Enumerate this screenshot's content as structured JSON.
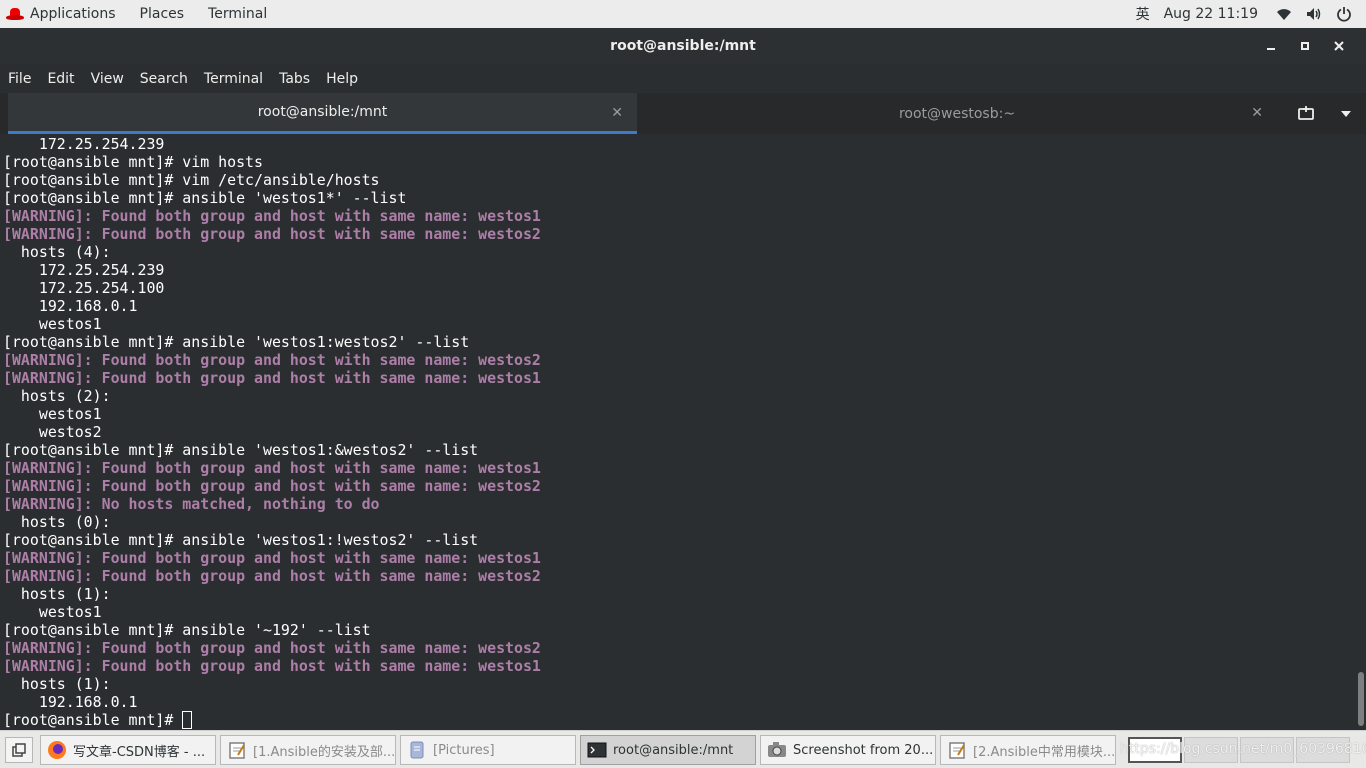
{
  "topbar": {
    "applications": "Applications",
    "places": "Places",
    "terminal": "Terminal",
    "ime": "英",
    "datetime": "Aug 22  11:19",
    "icons": [
      "wifi-icon",
      "volume-icon",
      "power-icon"
    ]
  },
  "window": {
    "title": "root@ansible:/mnt",
    "buttons": [
      "minimize",
      "maximize",
      "close"
    ]
  },
  "menubar": [
    "File",
    "Edit",
    "View",
    "Search",
    "Terminal",
    "Tabs",
    "Help"
  ],
  "tabs": [
    {
      "label": "root@ansible:/mnt",
      "active": true
    },
    {
      "label": "root@westosb:~",
      "active": false
    }
  ],
  "terminal": {
    "lines": [
      {
        "text": "    172.25.254.239",
        "type": "normal"
      },
      {
        "text": "[root@ansible mnt]# vim hosts",
        "type": "normal"
      },
      {
        "text": "[root@ansible mnt]# vim /etc/ansible/hosts",
        "type": "normal"
      },
      {
        "text": "[root@ansible mnt]# ansible 'westos1*' --list",
        "type": "normal"
      },
      {
        "text": "[WARNING]: Found both group and host with same name: westos1",
        "type": "warn"
      },
      {
        "text": "[WARNING]: Found both group and host with same name: westos2",
        "type": "warn"
      },
      {
        "text": "  hosts (4):",
        "type": "normal"
      },
      {
        "text": "    172.25.254.239",
        "type": "normal"
      },
      {
        "text": "    172.25.254.100",
        "type": "normal"
      },
      {
        "text": "    192.168.0.1",
        "type": "normal"
      },
      {
        "text": "    westos1",
        "type": "normal"
      },
      {
        "text": "[root@ansible mnt]# ansible 'westos1:westos2' --list",
        "type": "normal"
      },
      {
        "text": "[WARNING]: Found both group and host with same name: westos2",
        "type": "warn"
      },
      {
        "text": "[WARNING]: Found both group and host with same name: westos1",
        "type": "warn"
      },
      {
        "text": "  hosts (2):",
        "type": "normal"
      },
      {
        "text": "    westos1",
        "type": "normal"
      },
      {
        "text": "    westos2",
        "type": "normal"
      },
      {
        "text": "[root@ansible mnt]# ansible 'westos1:&westos2' --list",
        "type": "normal"
      },
      {
        "text": "[WARNING]: Found both group and host with same name: westos1",
        "type": "warn"
      },
      {
        "text": "[WARNING]: Found both group and host with same name: westos2",
        "type": "warn"
      },
      {
        "text": "[WARNING]: No hosts matched, nothing to do",
        "type": "warn"
      },
      {
        "text": "  hosts (0):",
        "type": "normal"
      },
      {
        "text": "[root@ansible mnt]# ansible 'westos1:!westos2' --list",
        "type": "normal"
      },
      {
        "text": "[WARNING]: Found both group and host with same name: westos1",
        "type": "warn"
      },
      {
        "text": "[WARNING]: Found both group and host with same name: westos2",
        "type": "warn"
      },
      {
        "text": "  hosts (1):",
        "type": "normal"
      },
      {
        "text": "    westos1",
        "type": "normal"
      },
      {
        "text": "[root@ansible mnt]# ansible '~192' --list",
        "type": "normal"
      },
      {
        "text": "[WARNING]: Found both group and host with same name: westos2",
        "type": "warn"
      },
      {
        "text": "[WARNING]: Found both group and host with same name: westos1",
        "type": "warn"
      },
      {
        "text": "  hosts (1):",
        "type": "normal"
      },
      {
        "text": "    192.168.0.1",
        "type": "normal"
      }
    ],
    "prompt": "[root@ansible mnt]# "
  },
  "taskbar": {
    "tasks": [
      {
        "label": "写文章-CSDN博客 - ...",
        "icon": "firefox-icon",
        "active": false,
        "dim": false
      },
      {
        "label": "[1.Ansible的安装及部...",
        "icon": "text-editor-icon",
        "active": false,
        "dim": true
      },
      {
        "label": "[Pictures]",
        "icon": "file-manager-icon",
        "active": false,
        "dim": true
      },
      {
        "label": "root@ansible:/mnt",
        "icon": "terminal-icon",
        "active": true,
        "dim": false
      },
      {
        "label": "Screenshot from 20...",
        "icon": "screenshot-icon",
        "active": false,
        "dim": false
      },
      {
        "label": "[2.Ansible中常用模块...",
        "icon": "text-editor-icon",
        "active": false,
        "dim": true
      }
    ],
    "watermark": "https://blog.csdn.net/m0_60396816"
  }
}
